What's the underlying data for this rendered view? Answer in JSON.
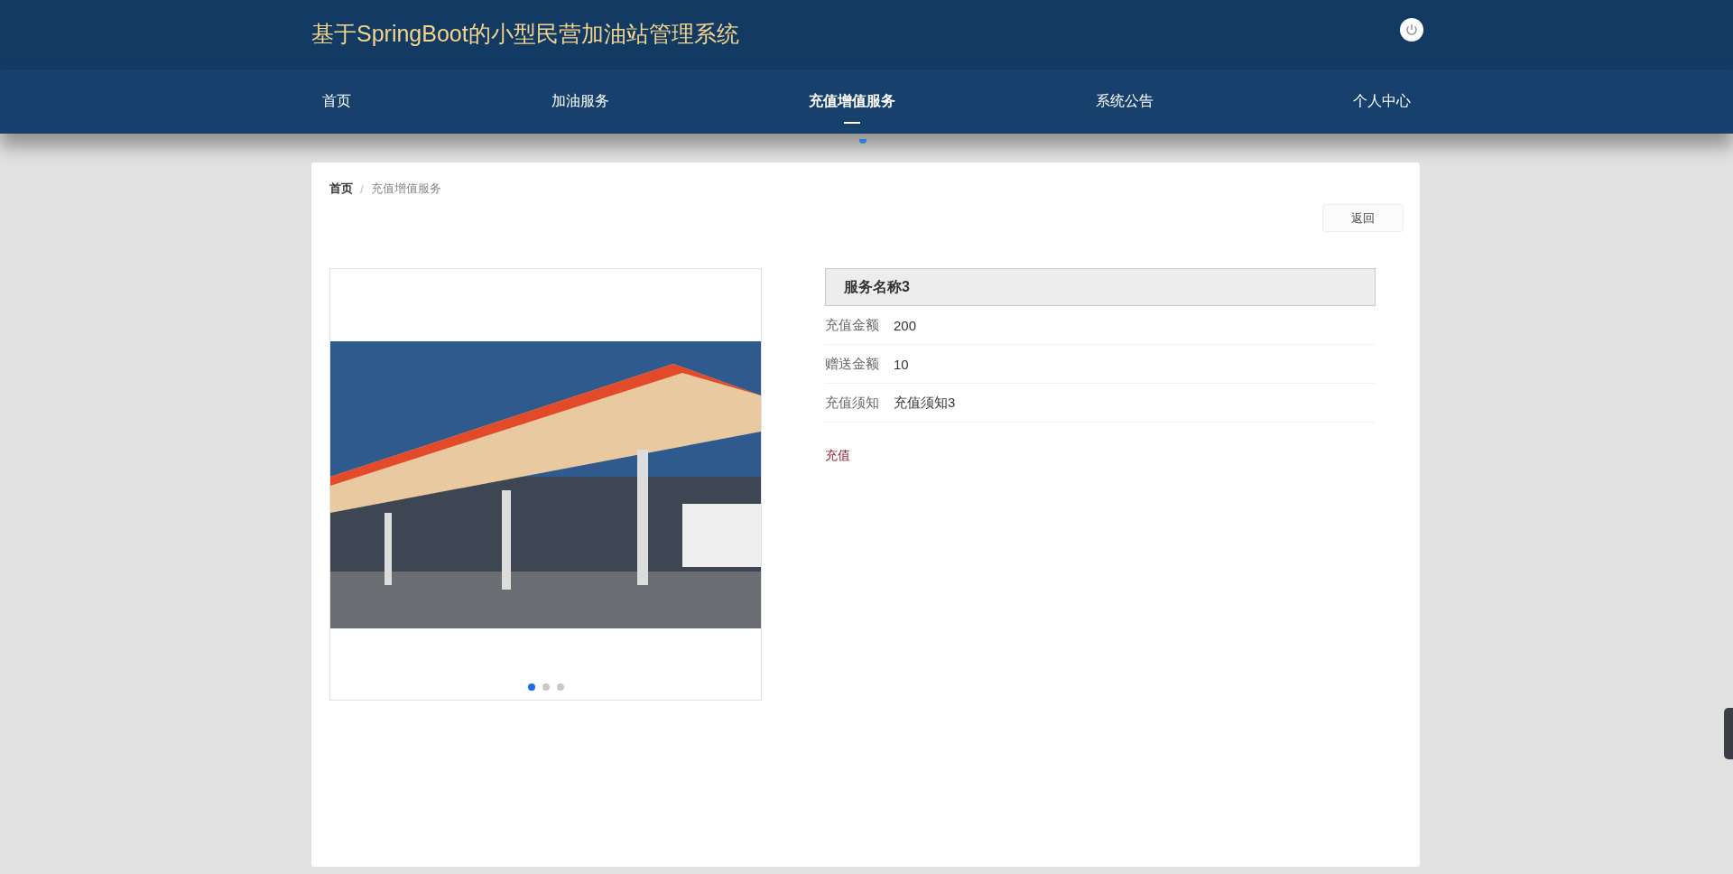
{
  "header": {
    "title": "基于SpringBoot的小型民营加油站管理系统"
  },
  "nav": [
    {
      "label": "首页",
      "selected": false
    },
    {
      "label": "加油服务",
      "selected": false
    },
    {
      "label": "充值增值服务",
      "selected": true
    },
    {
      "label": "系统公告",
      "selected": false
    },
    {
      "label": "个人中心",
      "selected": false
    }
  ],
  "breadcrumb": [
    {
      "label": "首页"
    },
    {
      "label": "充值增值服务"
    }
  ],
  "breadcrumb_separator": "/",
  "back_button": "返回",
  "carousel": {
    "dots": [
      {
        "selected": true
      },
      {
        "selected": false
      },
      {
        "selected": false
      }
    ]
  },
  "detail": {
    "title": "服务名称3",
    "rows": [
      {
        "label": "充值金额",
        "value": "200"
      },
      {
        "label": "赠送金额",
        "value": "10"
      },
      {
        "label": "充值须知",
        "value": "充值须知3"
      }
    ],
    "action": "充值"
  }
}
